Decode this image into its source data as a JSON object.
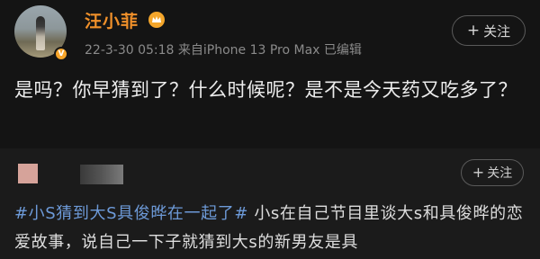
{
  "post": {
    "username": "汪小菲",
    "meta": "22-3-30 05:18  来自iPhone 13 Pro Max  已编辑",
    "follow_label": "关注",
    "follow_plus": "+",
    "verified_badge": "V",
    "content": "是吗？你早猜到了？什么时候呢？是不是今天药又吃多了？"
  },
  "repost": {
    "follow_label": "关注",
    "follow_plus": "+",
    "hashtag": "#小S猜到大S具俊晔在一起了#",
    "text": " 小s在自己节目里谈大s和具俊晔的恋爱故事，说自己一下子就猜到大s的新男友是具"
  },
  "colors": {
    "username": "#f0902a",
    "hashtag": "#6d9ad8",
    "background": "#141414"
  },
  "icons": {
    "crown": "crown-icon",
    "verified": "verified-badge-icon"
  }
}
